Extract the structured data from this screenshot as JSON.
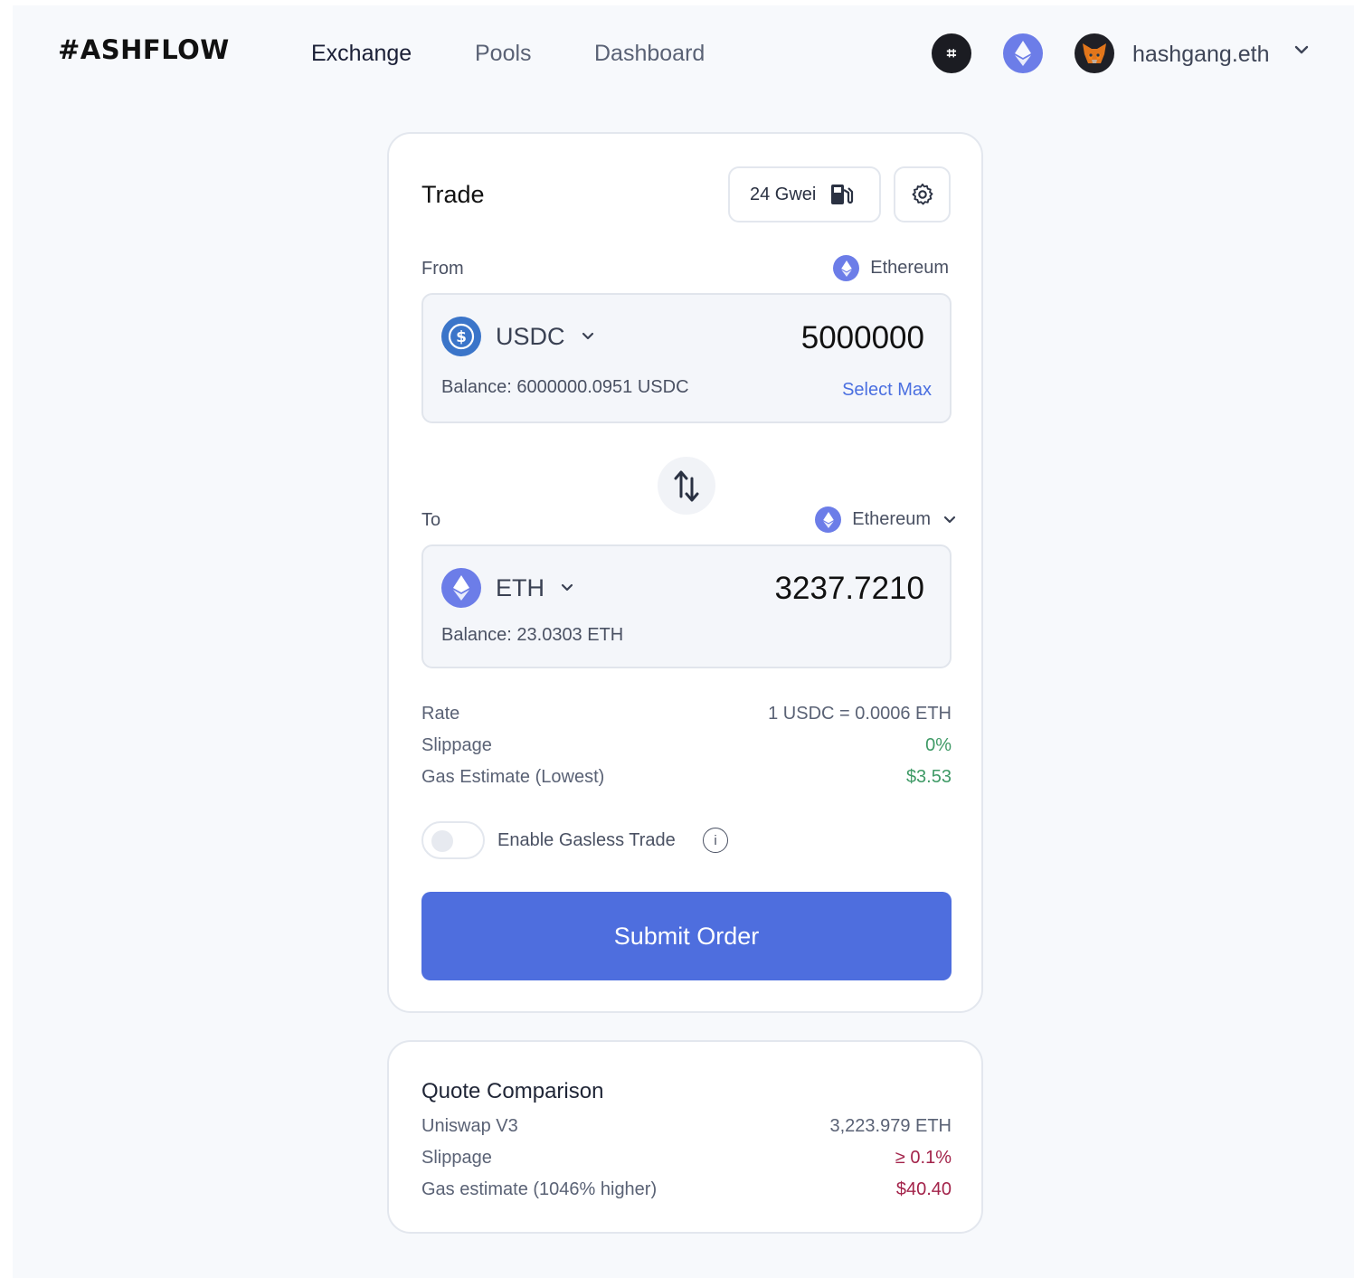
{
  "header": {
    "logo": "#ASHFLOW",
    "nav": [
      "Exchange",
      "Pools",
      "Dashboard"
    ],
    "account_name": "hashgang.eth",
    "hash_badge": "⌗"
  },
  "trade": {
    "title": "Trade",
    "gas_price": "24 Gwei",
    "from": {
      "label": "From",
      "chain": "Ethereum",
      "token": "USDC",
      "amount": "5000000",
      "balance": "Balance: 6000000.0951 USDC",
      "select_max": "Select Max"
    },
    "to": {
      "label": "To",
      "chain": "Ethereum",
      "token": "ETH",
      "amount": "3237.7210",
      "balance": "Balance: 23.0303 ETH"
    },
    "details": [
      {
        "label": "Rate",
        "value": "1 USDC = 0.0006 ETH",
        "tone": "neutral"
      },
      {
        "label": "Slippage",
        "value": "0%",
        "tone": "green"
      },
      {
        "label": "Gas Estimate (Lowest)",
        "value": "$3.53",
        "tone": "green"
      }
    ],
    "gasless_label": "Enable Gasless Trade",
    "gasless_enabled": false,
    "info_glyph": "i",
    "submit_label": "Submit Order"
  },
  "quote": {
    "title": "Quote Comparison",
    "rows": [
      {
        "label": "Uniswap V3",
        "value": "3,223.979 ETH",
        "tone": "neutral"
      },
      {
        "label": "Slippage",
        "value": "≥ 0.1%",
        "tone": "red"
      },
      {
        "label": "Gas estimate (1046% higher)",
        "value": "$40.40",
        "tone": "red"
      }
    ]
  },
  "colors": {
    "accent": "#4e6ede",
    "eth_purple": "#6c7de8",
    "usdc_blue": "#3b75c9",
    "positive": "#3f9a66",
    "negative": "#a3234a"
  },
  "icons": [
    "hashflow-icon",
    "ethereum-icon",
    "metamask-fox-icon",
    "chevron-down-icon",
    "gas-pump-icon",
    "gear-icon",
    "usdc-icon",
    "swap-arrows-icon",
    "info-icon"
  ]
}
